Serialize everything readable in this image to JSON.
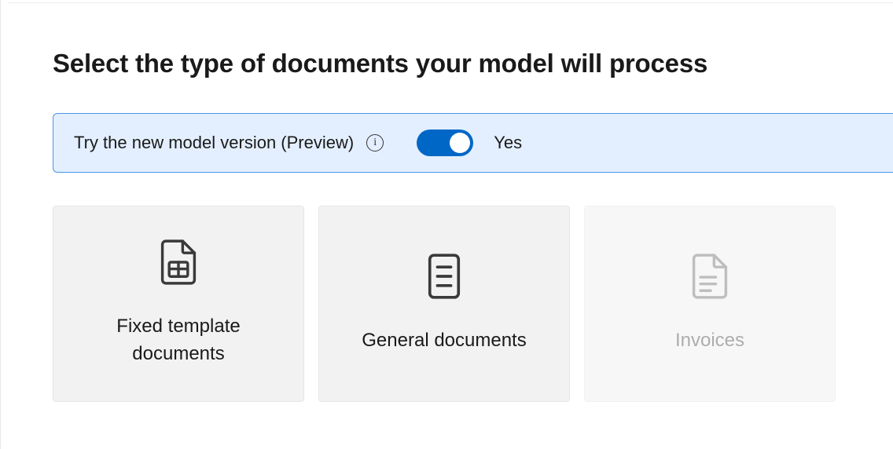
{
  "page": {
    "title": "Select the type of documents your model will process"
  },
  "preview": {
    "label": "Try the new model version (Preview)",
    "toggle_state": "Yes",
    "toggle_on": true
  },
  "cards": [
    {
      "label": "Fixed template documents",
      "enabled": true,
      "icon": "fixed-template-document-icon"
    },
    {
      "label": "General documents",
      "enabled": true,
      "icon": "general-document-icon"
    },
    {
      "label": "Invoices",
      "enabled": false,
      "icon": "invoice-document-icon"
    }
  ]
}
